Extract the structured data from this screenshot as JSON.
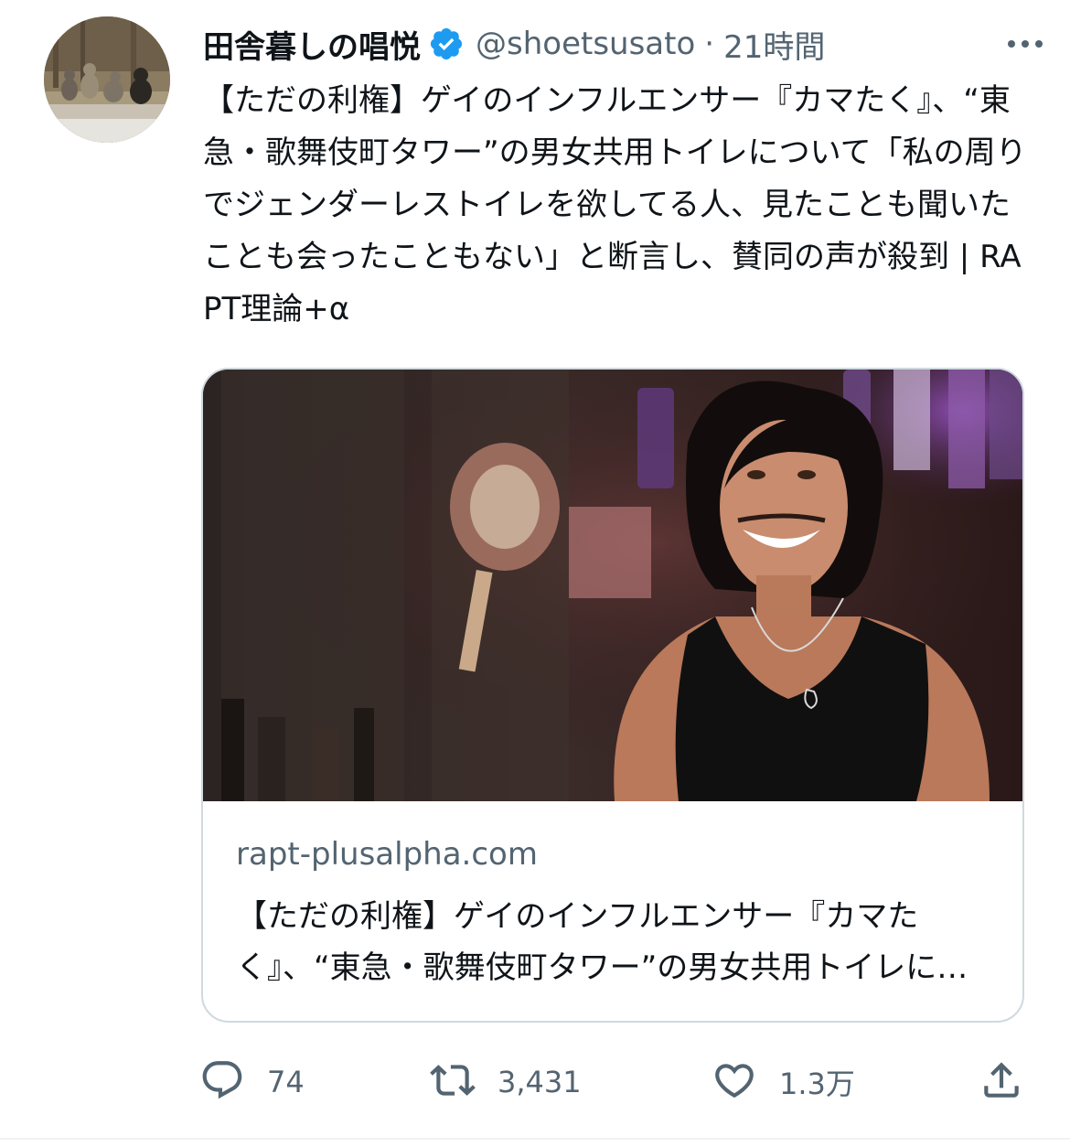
{
  "author": {
    "display_name": "田舎暮しの唱悦",
    "handle": "@shoetsusato",
    "separator": "·",
    "time": "21時間",
    "verified": true
  },
  "tweet": {
    "text": "【ただの利権】ゲイのインフルエンサー『カマたく』、“東急・歌舞伎町タワー”の男女共用トイレについて「私の周りでジェンダーレストイレを欲してる人、見たことも聞いたことも会ったこともない」と断言し、賛同の声が殺到 | RAPT理論+α"
  },
  "card": {
    "domain": "rapt-plusalpha.com",
    "title": "【ただの利権】ゲイのインフルエンサー『カマたく』、“東急・歌舞伎町タワー”の男女共用トイレについて「私の周りでジェンダーレストイレを欲してる人、見たことも聞いたことも会ったこともない」と断言し、賛同の声が殺到"
  },
  "actions": {
    "reply_count": "74",
    "retweet_count": "3,431",
    "like_count": "1.3万"
  },
  "icons": {
    "verified": "verified-badge-icon",
    "more": "more-icon",
    "reply": "reply-icon",
    "retweet": "retweet-icon",
    "like": "like-icon",
    "share": "share-icon"
  },
  "colors": {
    "verified_blue": "#1d9bf0",
    "secondary_text": "#536471",
    "primary_text": "#0f1419",
    "border": "#cfd9de"
  }
}
